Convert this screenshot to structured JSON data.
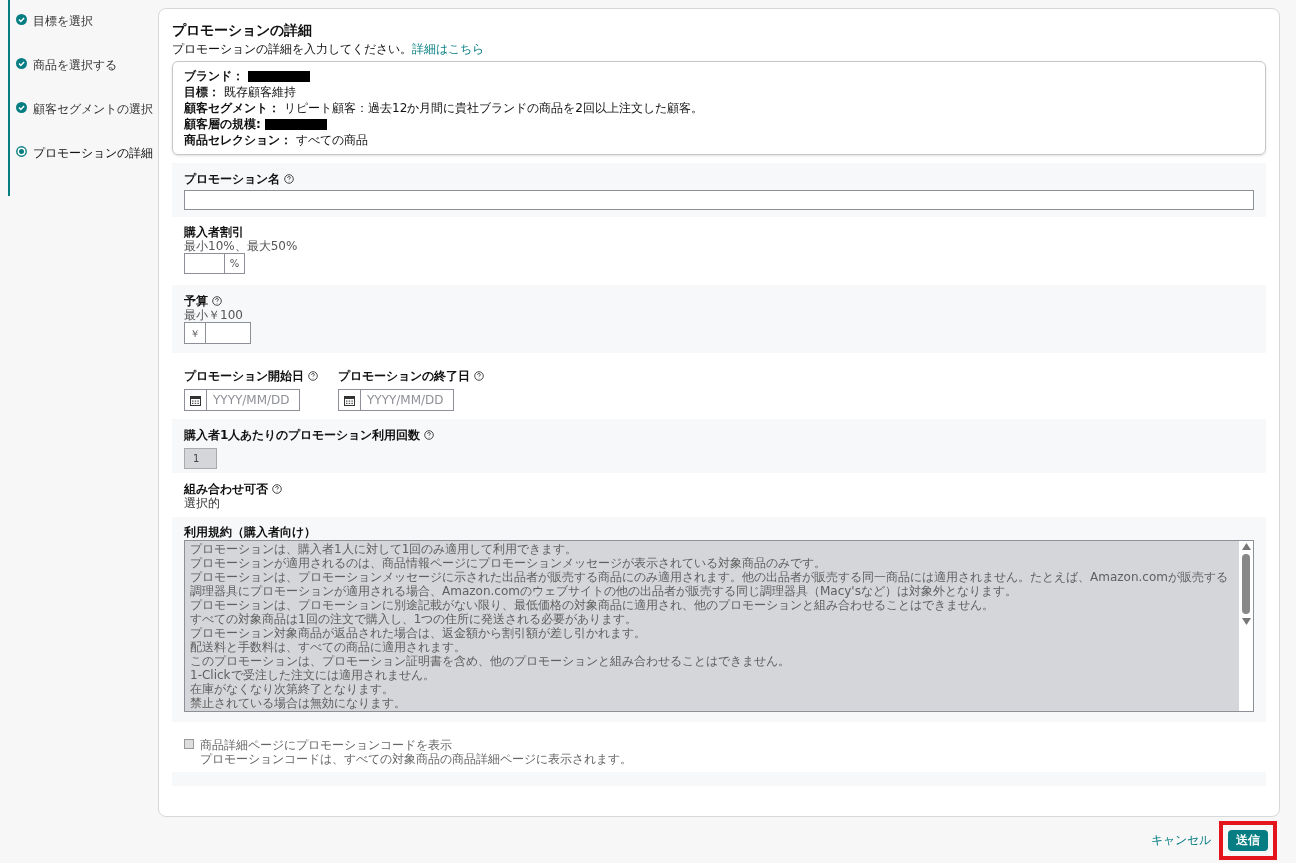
{
  "steps": [
    {
      "label": "目標を選択",
      "kind": "done"
    },
    {
      "label": "商品を選択する",
      "kind": "done"
    },
    {
      "label": "顧客セグメントの選択",
      "kind": "done"
    },
    {
      "label": "プロモーションの詳細",
      "kind": "current"
    }
  ],
  "title": "プロモーションの詳細",
  "intro": {
    "text": "プロモーションの詳細を入力してください。",
    "link": "詳細はこちら"
  },
  "summary": [
    {
      "label": "ブランド：",
      "redacted": true
    },
    {
      "label": "目標：",
      "value": "既存顧客維持",
      "redacted": false
    },
    {
      "label": "顧客セグメント：",
      "value": "リピート顧客：過去12か月間に貴社ブランドの商品を2回以上注文した顧客。",
      "redacted": false
    },
    {
      "label": "顧客層の規模:",
      "redacted": true
    },
    {
      "label": "商品セレクション：",
      "value": "すべての商品",
      "redacted": false
    }
  ],
  "promotion_name": {
    "label": "プロモーション名",
    "help": true
  },
  "discount": {
    "label": "購入者割引",
    "help": false,
    "hint": "最小10%、最大50%",
    "unit": "%"
  },
  "budget": {
    "label": "予算",
    "help": true,
    "hint": "最小￥100",
    "unit": "￥"
  },
  "start_date": {
    "label": "プロモーション開始日",
    "placeholder": "YYYY/MM/DD"
  },
  "end_date": {
    "label": "プロモーションの終了日",
    "placeholder": "YYYY/MM/DD"
  },
  "uses_per_buyer": {
    "label": "購入者1人あたりのプロモーション利用回数",
    "value": "1",
    "disabled": true
  },
  "combinable": {
    "label": "組み合わせ可否",
    "value": "選択的"
  },
  "terms": {
    "label": "利用規約（購入者向け）",
    "disabled": true,
    "lines": [
      "プロモーションは、購入者1人に対して1回のみ適用して利用できます。",
      "プロモーションが適用されるのは、商品情報ページにプロモーションメッセージが表示されている対象商品のみです。",
      "プロモーションは、プロモーションメッセージに示された出品者が販売する商品にのみ適用されます。他の出品者が販売する同一商品には適用されません。たとえば、Amazon.comが販売する調理器具にプロモーションが適用される場合、Amazon.comのウェブサイトの他の出品者が販売する同じ調理器具（Macy'sなど）は対象外となります。",
      "プロモーションは、プロモーションに別途記載がない限り、最低価格の対象商品に適用され、他のプロモーションと組み合わせることはできません。",
      "すべての対象商品は1回の注文で購入し、1つの住所に発送される必要があります。",
      "プロモーション対象商品が返品された場合は、返金額から割引額が差し引かれます。",
      "配送料と手数料は、すべての商品に適用されます。",
      "このプロモーションは、プロモーション証明書を含め、他のプロモーションと組み合わせることはできません。",
      "1-Clickで受注した注文には適用されません。",
      "在庫がなくなり次第終了となります。",
      "禁止されている場合は無効になります。"
    ]
  },
  "show_code": {
    "label": "商品詳細ページにプロモーションコードを表示",
    "note": "プロモーションコードは、すべての対象商品の商品詳細ページに表示されます。",
    "checked": false,
    "disabled": true
  },
  "actions": {
    "cancel": "キャンセル",
    "submit": "送信",
    "submit_highlighted": true
  }
}
